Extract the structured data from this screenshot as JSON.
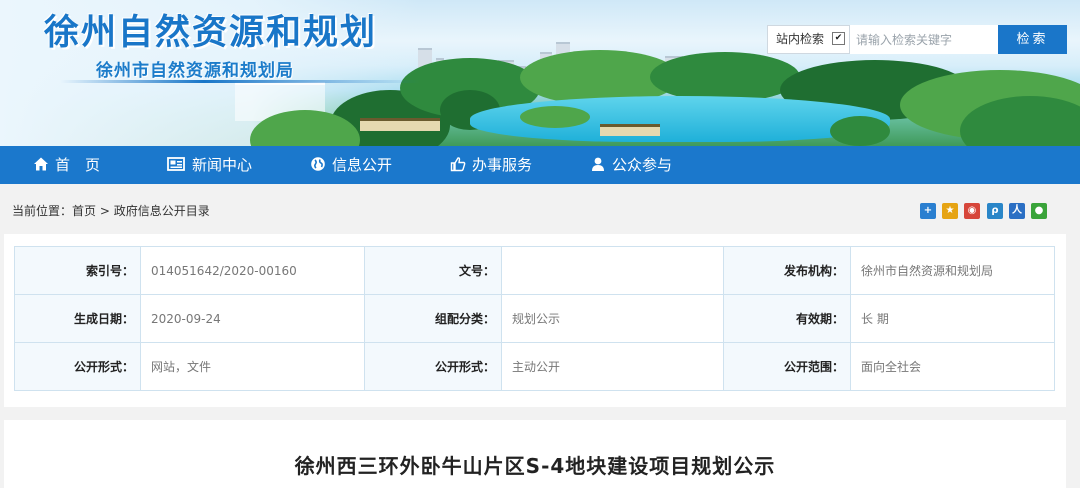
{
  "header": {
    "logo_title": "徐州自然资源和规划",
    "logo_subtitle": "徐州市自然资源和规划局"
  },
  "search": {
    "scope_label": "站内检索",
    "placeholder": "请输入检索关键字",
    "button_label": "检索"
  },
  "nav": {
    "items": [
      {
        "label": "首　页",
        "icon": "home-icon"
      },
      {
        "label": "新闻中心",
        "icon": "newspaper-icon"
      },
      {
        "label": "信息公开",
        "icon": "globe-icon"
      },
      {
        "label": "办事服务",
        "icon": "thumbs-up-icon"
      },
      {
        "label": "公众参与",
        "icon": "user-icon"
      }
    ]
  },
  "breadcrumb": {
    "prefix": "当前位置：",
    "home": "首页",
    "sep": ">",
    "current": "政府信息公开目录"
  },
  "share": {
    "icons": [
      "plus-share-icon",
      "qzone-icon",
      "weibo-icon",
      "tencent-weibo-icon",
      "renren-icon",
      "wechat-icon"
    ],
    "colors": [
      "#2a7fd0",
      "#e6a413",
      "#d7463a",
      "#2a86c8",
      "#2b6fc4",
      "#3aa43a"
    ]
  },
  "info": {
    "rows": [
      [
        {
          "label": "索引号：",
          "value": "014051642/2020-00160"
        },
        {
          "label": "文号：",
          "value": ""
        },
        {
          "label": "发布机构：",
          "value": "徐州市自然资源和规划局"
        }
      ],
      [
        {
          "label": "生成日期：",
          "value": "2020-09-24"
        },
        {
          "label": "组配分类：",
          "value": "规划公示"
        },
        {
          "label": "有效期：",
          "value": "长 期"
        }
      ],
      [
        {
          "label": "公开形式：",
          "value": "网站，文件"
        },
        {
          "label": "公开形式：",
          "value": "主动公开"
        },
        {
          "label": "公开范围：",
          "value": "面向全社会"
        }
      ]
    ]
  },
  "article": {
    "title": "徐州西三环外卧牛山片区S-4地块建设项目规划公示"
  },
  "colors": {
    "brand_blue": "#1b78cc",
    "border": "#cfe2ef"
  }
}
